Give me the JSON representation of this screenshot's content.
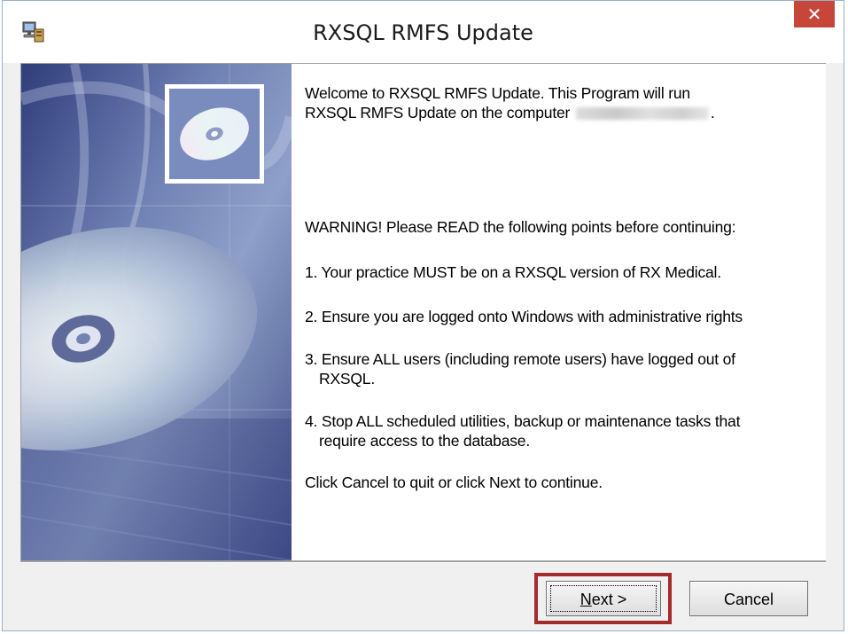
{
  "window": {
    "title": "RXSQL RMFS Update",
    "close_glyph": "✕",
    "app_icon": "installer-computer-icon"
  },
  "welcome": {
    "line1": "Welcome to RXSQL RMFS Update.  This Program will run",
    "line2_prefix": "RXSQL RMFS Update on the computer",
    "line2_suffix": "."
  },
  "warning": "WARNING! Please READ the following points before continuing:",
  "points": {
    "p1": "1. Your practice MUST be on a RXSQL version of RX Medical.",
    "p2": "2. Ensure you are logged onto Windows with administrative rights",
    "p3_line1": "3. Ensure ALL users (including remote users) have logged out of",
    "p3_line2": "RXSQL.",
    "p4_line1": "4. Stop ALL scheduled utilities, backup or maintenance tasks that",
    "p4_line2": "require access to the database."
  },
  "closing": "Click Cancel to quit or click Next to continue.",
  "buttons": {
    "next_mnemonic": "N",
    "next_rest": "ext >",
    "cancel": "Cancel"
  },
  "colors": {
    "close_button": "#c7463a",
    "highlight_box": "#a52a2a",
    "side_panel": "#5a6a9a"
  }
}
